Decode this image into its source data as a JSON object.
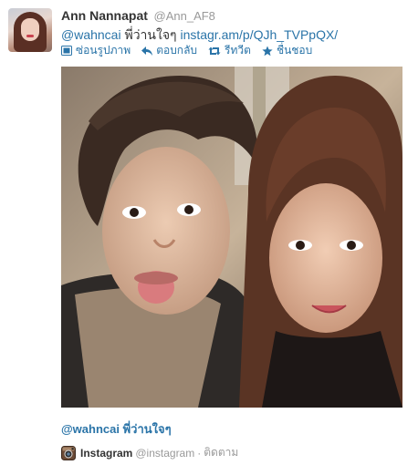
{
  "user": {
    "full_name": "Ann Nannapat",
    "username": "@Ann_AF8"
  },
  "tweet": {
    "mention": "@wahncai",
    "text": "พี่ว่านใจๆ",
    "link": "instagr.am/p/QJh_TVPpQX/"
  },
  "actions": {
    "hide_photo": "ซ่อนรูปภาพ",
    "reply": "ตอบกลับ",
    "retweet": "รีทวีต",
    "favorite": "ชื่นชอบ"
  },
  "caption": {
    "mention": "@wahncai",
    "text": "พี่ว่านใจๆ"
  },
  "attribution": {
    "service_name": "Instagram",
    "service_handle": "@instagram",
    "separator": "·",
    "follow_label": "ติดตาม"
  },
  "colors": {
    "link": "#2a74a8",
    "muted": "#999999",
    "text": "#333333"
  },
  "icons": [
    "photo-icon",
    "reply-icon",
    "retweet-icon",
    "star-icon",
    "instagram-icon"
  ]
}
